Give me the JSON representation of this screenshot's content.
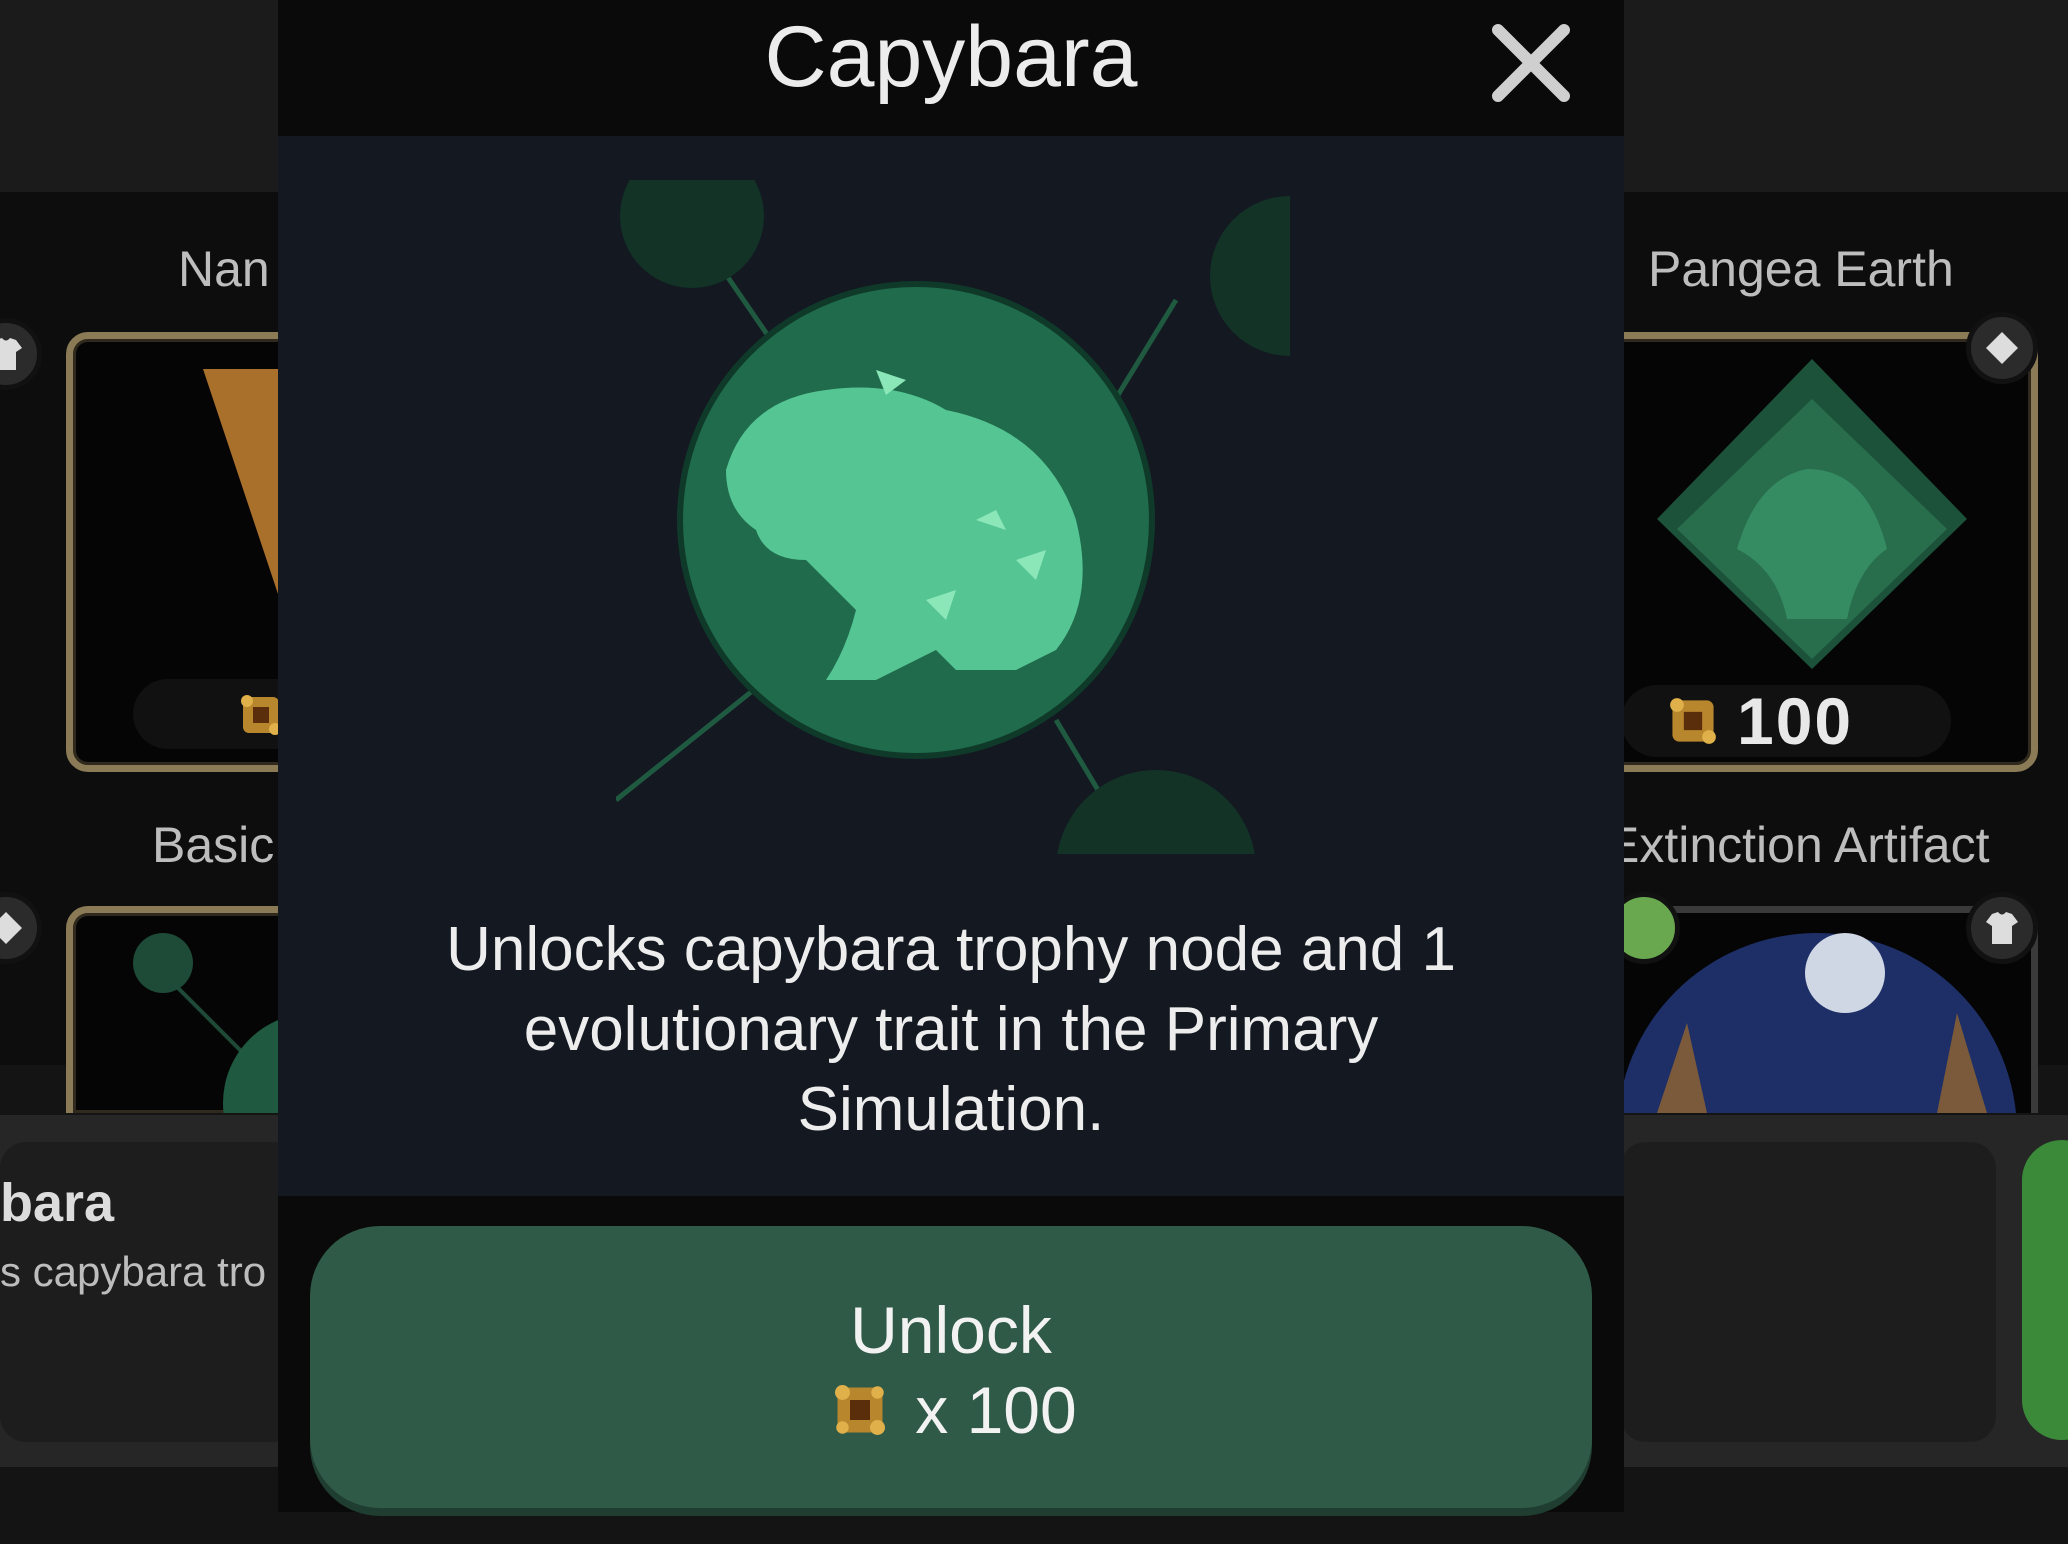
{
  "background": {
    "shelf_left_top_label": "Nan",
    "shelf_left_bottom_label": "Basic",
    "shelf_right_top_label": "Pangea Earth",
    "shelf_right_top_price": "100",
    "shelf_right_bottom_label": "Extinction Artifact",
    "bottom_title": "bara",
    "bottom_subtitle": "s capybara tro"
  },
  "modal": {
    "title": "Capybara",
    "description": "Unlocks capybara trophy node and 1 evolutionary trait in the Primary Simulation.",
    "unlock_label": "Unlock",
    "unlock_cost": "x 100",
    "currency_icon": "dna-cube-icon",
    "close_icon": "close-icon",
    "colors": {
      "accent_green": "#2f5a47",
      "art_green": "#3fae7a",
      "frame_gold": "#8a7a55"
    }
  }
}
